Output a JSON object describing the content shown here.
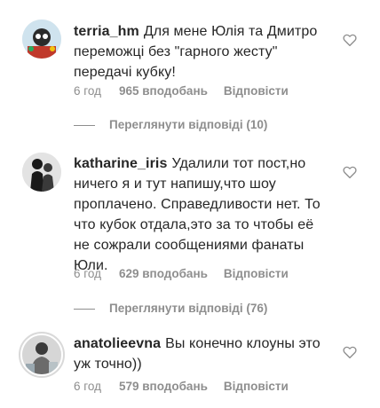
{
  "comments": [
    {
      "username": "terria_hm",
      "text": "Для мене Юлія та Дмитро переможці без \"гарного жесту\" передачі кубку!",
      "time": "6 год",
      "likes": "965 вподобань",
      "reply_label": "Відповісти",
      "view_replies": "Переглянути відповіді (10)"
    },
    {
      "username": "katharine_iris",
      "text": "Удалили тот пост,но ничего я и тут напишу,что шоу проплачено. Справедливости нет. То что кубок отдала,это за то чтобы её не сожрали сообщениями фанаты Юли.",
      "time": "6 год",
      "likes": "629 вподобань",
      "reply_label": "Відповісти",
      "view_replies": "Переглянути відповіді (76)"
    },
    {
      "username": "anatolieevna",
      "text": "Вы конечно клоуны это уж точно))",
      "time": "6 год",
      "likes": "579 вподобань",
      "reply_label": "Відповісти"
    }
  ],
  "colors": {
    "text": "#262626",
    "secondary": "#8e8e8e",
    "background": "#ffffff"
  },
  "icons": {
    "like": "heart-outline-icon"
  }
}
